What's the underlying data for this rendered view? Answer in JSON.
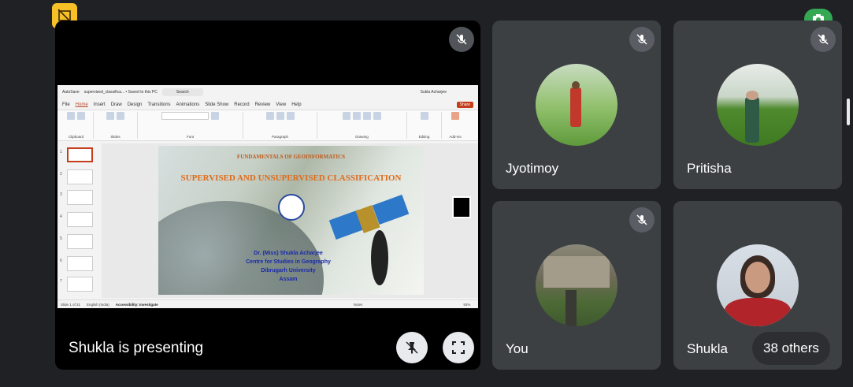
{
  "main": {
    "presenter_label": "Shukla is presenting",
    "presentation": {
      "title_bar": {
        "autosave": "AutoSave",
        "filename": "supervised_classifica... • Saved to this PC",
        "search": "Search",
        "user": "Sukla Acharjee"
      },
      "menu": [
        "File",
        "Home",
        "Insert",
        "Draw",
        "Design",
        "Transitions",
        "Animations",
        "Slide Show",
        "Record",
        "Review",
        "View",
        "Help"
      ],
      "share": "Share",
      "ribbon_groups": [
        "Clipboard",
        "Slides",
        "Font",
        "Paragraph",
        "Drawing",
        "Editing",
        "Add-ins"
      ],
      "slide": {
        "heading": "FUNDAMENTALS OF GEOINFORMATICS",
        "title": "SUPERVISED AND UNSUPERVISED CLASSIFICATION",
        "author_line1": "Dr. (Miss) Shukla Acharjee",
        "author_line2": "Centre for Studies in Geography",
        "author_line3": "Dibrugarh University",
        "author_line4": "Assam"
      },
      "thumb_numbers": [
        "1",
        "2",
        "3",
        "4",
        "5",
        "6",
        "7"
      ],
      "status": {
        "slide_info": "Slide 1 of 31",
        "language": "English (India)",
        "accessibility": "Accessibility: Investigate",
        "notes": "Notes",
        "zoom": "93%"
      }
    }
  },
  "participants": [
    {
      "name": "Jyotimoy",
      "muted": true
    },
    {
      "name": "Pritisha",
      "muted": true
    },
    {
      "name": "You",
      "muted": true
    },
    {
      "name": "Shukla",
      "muted": false
    }
  ],
  "others_label": "38 others",
  "colors": {
    "background": "#202124",
    "tile": "#3c4043",
    "badge_yellow": "#f6c026",
    "badge_green": "#34a853"
  }
}
